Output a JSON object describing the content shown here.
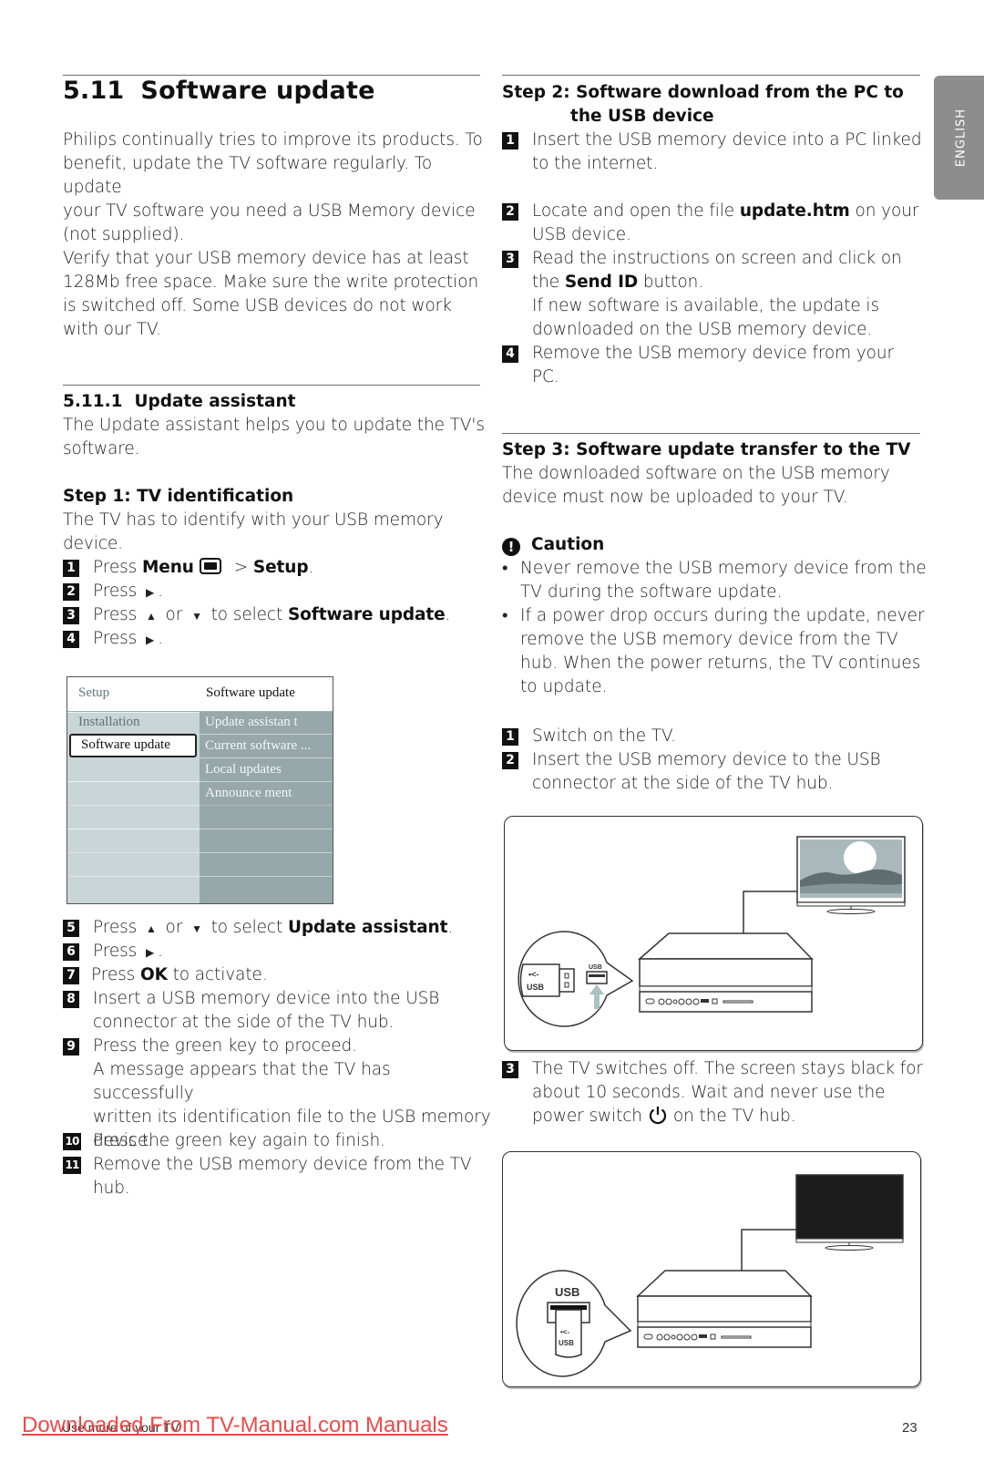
{
  "language_tab": "ENGLISH",
  "section": {
    "number": "5.11",
    "title": "Software update",
    "intro_paragraphs": [
      [
        "Philips continually tries to improve its products. To",
        "benefit, update the TV software regularly. To update",
        "your TV software you need a USB Memory device",
        "(not supplied)."
      ],
      [
        "Verify that your USB memory device has at least",
        "128Mb free space. Make sure the write protection",
        "is switched off. Some USB devices do not work",
        "with our TV."
      ]
    ]
  },
  "subsection": {
    "number": "5.11.1",
    "title": "Update assistant",
    "description": [
      "The Update assistant helps you to update the TV's",
      "software."
    ]
  },
  "step1": {
    "title": "Step 1: TV identification",
    "description": [
      "The TV has to identify with your USB memory",
      "device."
    ],
    "items_a": [
      {
        "n": "1",
        "pre": "Press ",
        "bold": "Menu",
        "icon": "menu-button-icon",
        "post": " > ",
        "bold2": "Setup",
        "end": "."
      },
      {
        "n": "2",
        "pre": "Press ",
        "icon": "right-arrow-icon",
        "end": "."
      },
      {
        "n": "3",
        "pre": "Press ",
        "icon": "up-arrow-icon",
        "mid": " or ",
        "icon2": "down-arrow-icon",
        "post": " to select ",
        "bold": "Software update",
        "end": "."
      },
      {
        "n": "4",
        "pre": "Press ",
        "icon": "right-arrow-icon",
        "end": "."
      }
    ],
    "items_b": [
      {
        "n": "5",
        "lines": [
          "Press ▲ or ▼ to select "
        ],
        "bold": "Update assistant",
        "end": "."
      },
      {
        "n": "6",
        "lines": [
          "Press ▶ ."
        ]
      },
      {
        "n": "7",
        "pre": "Press ",
        "bold": "OK",
        "post": " to activate."
      },
      {
        "n": "8",
        "lines": [
          "Insert a USB memory device into the USB",
          "connector at the side of the TV hub."
        ]
      },
      {
        "n": "9",
        "lines": [
          " Press the green key to proceed.",
          "A message appears that the TV has successfully",
          "written its identification file to the USB memory",
          "device."
        ]
      },
      {
        "n": "10",
        "lines": [
          "Press the green key again to finish."
        ]
      },
      {
        "n": "11",
        "lines": [
          "Remove the USB memory device from the TV",
          "hub."
        ]
      }
    ]
  },
  "menu_screen": {
    "header_left": "Setup",
    "header_right": "Software update",
    "left_items": [
      "Installation",
      "Software update"
    ],
    "selected_left": "Software update",
    "right_items": [
      "Update assistan t",
      "Current software ...",
      "Local updates",
      "Announce ment"
    ]
  },
  "step2": {
    "title_line1": "Step 2: Software download from the PC to",
    "title_line2": "the USB device",
    "items": [
      {
        "n": "1",
        "lines": [
          "Insert the USB memory device into a PC linked",
          "to the internet."
        ]
      },
      {
        "n": "2",
        "pre": "Locate and open the file ",
        "bold": "update.htm",
        "post": " on your",
        "lines": [
          "USB device."
        ]
      },
      {
        "n": "3",
        "line1": "Read the instructions on screen and click on",
        "pre": "the ",
        "bold": "Send ID",
        "post": " button.",
        "lines": [
          "If new software is available, the update is",
          "downloaded on the USB memory device."
        ]
      },
      {
        "n": "4",
        "lines": [
          "Remove the USB memory device from your",
          "PC."
        ]
      }
    ]
  },
  "step3": {
    "title": "Step 3: Software update transfer to the TV",
    "description": [
      "The downloaded software on the USB memory",
      "device must now be uploaded to your TV."
    ],
    "caution": {
      "title": "Caution",
      "bullets": [
        [
          "Never remove the USB memory device from the",
          "TV during the software update."
        ],
        [
          "If a power drop occurs during the update, never",
          "remove the USB memory device from the TV",
          "hub. When the power returns, the TV continues",
          "to update."
        ]
      ]
    },
    "items": [
      {
        "n": "1",
        "lines": [
          "Switch on the TV."
        ]
      },
      {
        "n": "2",
        "lines": [
          "Insert the USB memory device to the USB",
          "connector at the side of the TV hub."
        ]
      },
      {
        "n": "3",
        "lines": [
          "The TV switches off. The screen stays black for",
          "about 10 seconds. Wait and never use the"
        ],
        "pre": "power switch",
        "post": "on the TV hub."
      }
    ]
  },
  "illustrations": {
    "usb_label": "USB",
    "colors": {
      "tv_sky": "#a9b9bb",
      "tv_hills": "#5f6f71",
      "tv_water": "#869799",
      "arrow": "#a9c2c2",
      "tv_off": "#1c1c1c"
    }
  },
  "footer": {
    "chapter": "Use more of your TV",
    "page_number": "23",
    "watermark_link": "Downloaded From TV-Manual.com Manuals"
  }
}
